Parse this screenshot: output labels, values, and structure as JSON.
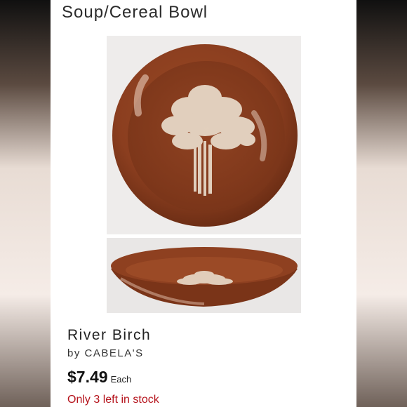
{
  "header": {
    "title": "Soup/Cereal Bowl"
  },
  "product": {
    "name": "River Birch",
    "brand": "by CABELA'S",
    "price": "$7.49",
    "unit": "Each",
    "stock": "Only 3 left in stock"
  },
  "colors": {
    "glaze": "#8b3e1f",
    "rim": "#7a3418",
    "tree": "#e9dccb",
    "stock_text": "#b5121b"
  }
}
